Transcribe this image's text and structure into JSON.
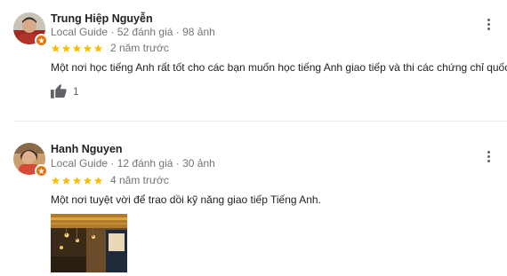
{
  "reviews": [
    {
      "author": "Trung Hiệp Nguyễn",
      "meta": "Local Guide · 52 đánh giá · 98 ảnh",
      "rating": 5,
      "date": "2 năm trước",
      "text": "Một nơi học tiếng Anh rất tốt cho các bạn muốn học tiếng Anh giao tiếp và thi các chứng chỉ quốc tế",
      "likes": "1",
      "more_icon": "more-vert-icon",
      "like_icon": "thumbs-up-icon"
    },
    {
      "author": "Hanh Nguyen",
      "meta": "Local Guide · 12 đánh giá · 30 ảnh",
      "rating": 5,
      "date": "4 năm trước",
      "text": "Một nơi tuyệt vời để trao dồi kỹ năng giao tiếp Tiếng Anh.",
      "more_icon": "more-vert-icon"
    }
  ],
  "colors": {
    "star": "#fbbc04",
    "guide_badge": "#e8710a",
    "secondary_text": "#70757a"
  }
}
